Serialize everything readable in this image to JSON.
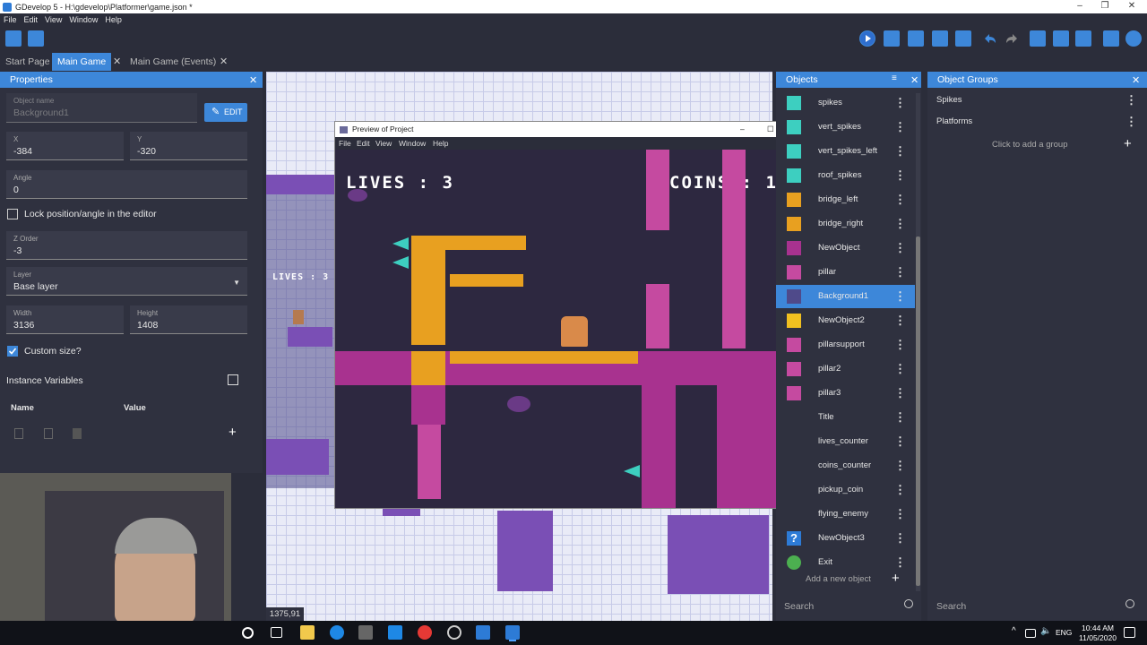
{
  "window": {
    "title": "GDevelop 5 - H:\\gdevelop\\Platformer\\game.json *",
    "minimize": "–",
    "maximize": "❐",
    "close": "✕"
  },
  "menu": [
    "File",
    "Edit",
    "View",
    "Window",
    "Help"
  ],
  "tabs": [
    {
      "label": "Start Page",
      "active": false
    },
    {
      "label": "Main Game",
      "active": true,
      "close": "✕"
    },
    {
      "label": "Main Game (Events)",
      "active": false,
      "close": "✕"
    }
  ],
  "properties": {
    "title": "Properties",
    "close": "✕",
    "object_name_label": "Object name",
    "object_name_value": "Background1",
    "edit_label": "EDIT",
    "x_label": "X",
    "x_value": "-384",
    "y_label": "Y",
    "y_value": "-320",
    "angle_label": "Angle",
    "angle_value": "0",
    "lock_label": "Lock position/angle in the editor",
    "lock_checked": false,
    "zorder_label": "Z Order",
    "zorder_value": "-3",
    "layer_label": "Layer",
    "layer_value": "Base layer",
    "width_label": "Width",
    "width_value": "3136",
    "height_label": "Height",
    "height_value": "1408",
    "custom_size_label": "Custom size?",
    "custom_size_checked": true,
    "instance_vars_label": "Instance Variables",
    "name_col": "Name",
    "value_col": "Value",
    "add": "+"
  },
  "scene": {
    "lives_label": "LIVES : 3",
    "coords": "1375,91"
  },
  "preview": {
    "title": "Preview of Project",
    "menu": [
      "File",
      "Edit",
      "View",
      "Window",
      "Help"
    ],
    "minimize": "–",
    "maximize": "☐",
    "close": "✕",
    "lives": "LIVES : 3",
    "coins": "COINS : 1"
  },
  "objects": {
    "title": "Objects",
    "close": "✕",
    "filter_icon": "filter-icon",
    "items": [
      {
        "name": "spikes",
        "icon": "spikes-icon",
        "selected": false
      },
      {
        "name": "vert_spikes",
        "icon": "vert-spikes-icon",
        "selected": false
      },
      {
        "name": "vert_spikes_left",
        "icon": "vert-spikes-left-icon",
        "selected": false
      },
      {
        "name": "roof_spikes",
        "icon": "roof-spikes-icon",
        "selected": false
      },
      {
        "name": "bridge_left",
        "icon": "bridge-left-icon",
        "selected": false
      },
      {
        "name": "bridge_right",
        "icon": "bridge-right-icon",
        "selected": false
      },
      {
        "name": "NewObject",
        "icon": "tile-icon",
        "selected": false
      },
      {
        "name": "pillar",
        "icon": "pillar-icon",
        "selected": false
      },
      {
        "name": "Background1",
        "icon": "background-icon",
        "selected": true
      },
      {
        "name": "NewObject2",
        "icon": "coin-icon",
        "selected": false
      },
      {
        "name": "pillarsupport",
        "icon": "pillar-support-icon",
        "selected": false
      },
      {
        "name": "pillar2",
        "icon": "pillar-icon",
        "selected": false
      },
      {
        "name": "pillar3",
        "icon": "pillar-icon",
        "selected": false
      },
      {
        "name": "Title",
        "icon": "text-icon",
        "selected": false
      },
      {
        "name": "lives_counter",
        "icon": "text-icon",
        "selected": false
      },
      {
        "name": "coins_counter",
        "icon": "text-icon",
        "selected": false
      },
      {
        "name": "pickup_coin",
        "icon": "coin-icon",
        "selected": false
      },
      {
        "name": "flying_enemy",
        "icon": "enemy-icon",
        "selected": false
      },
      {
        "name": "NewObject3",
        "icon": "question-icon",
        "selected": false
      },
      {
        "name": "Exit",
        "icon": "exit-icon",
        "selected": false
      }
    ],
    "add_label": "Add a new object",
    "add": "+",
    "search_placeholder": "Search"
  },
  "groups": {
    "title": "Object Groups",
    "close": "✕",
    "items": [
      "Spikes",
      "Platforms"
    ],
    "add_label": "Click to add a group",
    "add": "+",
    "search_placeholder": "Search"
  },
  "taskbar": {
    "time": "10:44 AM",
    "date": "11/05/2020",
    "lang": "ENG"
  },
  "colors": {
    "accent": "#3d87d9",
    "panel": "#2f313f",
    "background": "#2b2d3a"
  }
}
